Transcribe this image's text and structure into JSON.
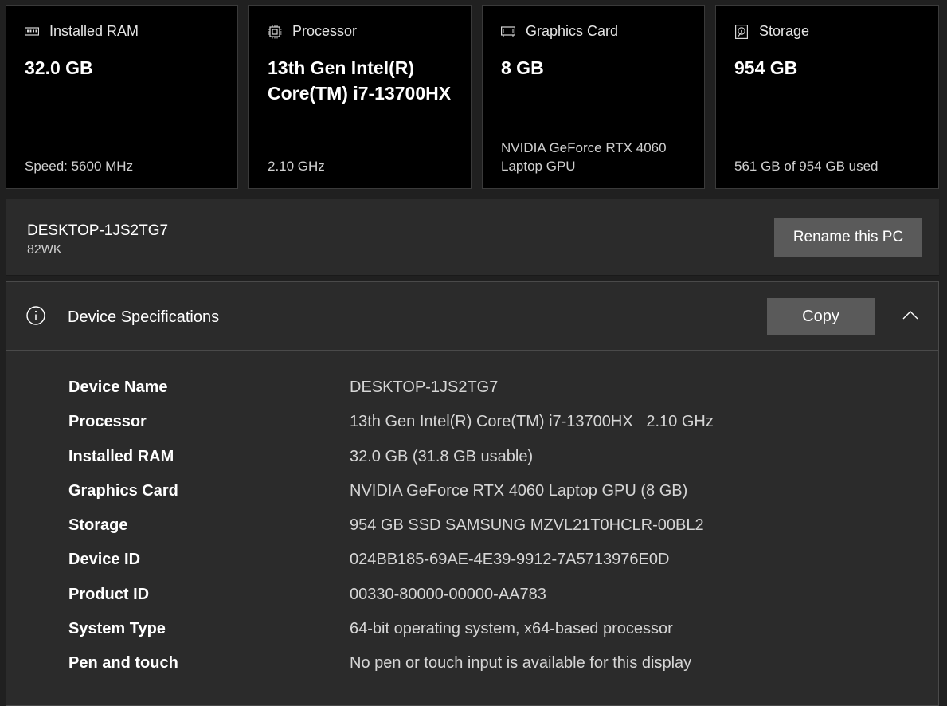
{
  "cards": [
    {
      "title": "Installed RAM",
      "icon": "ram-icon",
      "value": "32.0 GB",
      "footer": "Speed: 5600 MHz"
    },
    {
      "title": "Processor",
      "icon": "processor-icon",
      "value": "13th Gen Intel(R) Core(TM) i7-13700HX",
      "footer": "2.10 GHz"
    },
    {
      "title": "Graphics Card",
      "icon": "graphics-card-icon",
      "value": "8 GB",
      "footer": "NVIDIA GeForce RTX 4060 Laptop GPU"
    },
    {
      "title": "Storage",
      "icon": "storage-icon",
      "value": "954 GB",
      "footer": "561 GB of 954 GB used"
    }
  ],
  "pc": {
    "name": "DESKTOP-1JS2TG7",
    "model": "82WK",
    "rename_label": "Rename this PC"
  },
  "specs": {
    "title": "Device Specifications",
    "copy_label": "Copy",
    "rows": [
      {
        "label": "Device Name",
        "value": "DESKTOP-1JS2TG7"
      },
      {
        "label": "Processor",
        "value": "13th Gen Intel(R) Core(TM) i7-13700HX   2.10 GHz"
      },
      {
        "label": "Installed RAM",
        "value": "32.0 GB (31.8 GB usable)"
      },
      {
        "label": "Graphics Card",
        "value": "NVIDIA GeForce RTX 4060 Laptop GPU (8 GB)"
      },
      {
        "label": "Storage",
        "value": "954 GB SSD SAMSUNG MZVL21T0HCLR-00BL2"
      },
      {
        "label": "Device ID",
        "value": "024BB185-69AE-4E39-9912-7A5713976E0D"
      },
      {
        "label": "Product ID",
        "value": "00330-80000-00000-AA783"
      },
      {
        "label": "System Type",
        "value": "64-bit operating system, x64-based processor"
      },
      {
        "label": "Pen and touch",
        "value": "No pen or touch input is available for this display"
      }
    ]
  },
  "colors": {
    "page_bg": "#202020",
    "card_bg": "#000000",
    "panel_bg": "#2b2b2b",
    "button_bg": "#5a5a5a"
  }
}
